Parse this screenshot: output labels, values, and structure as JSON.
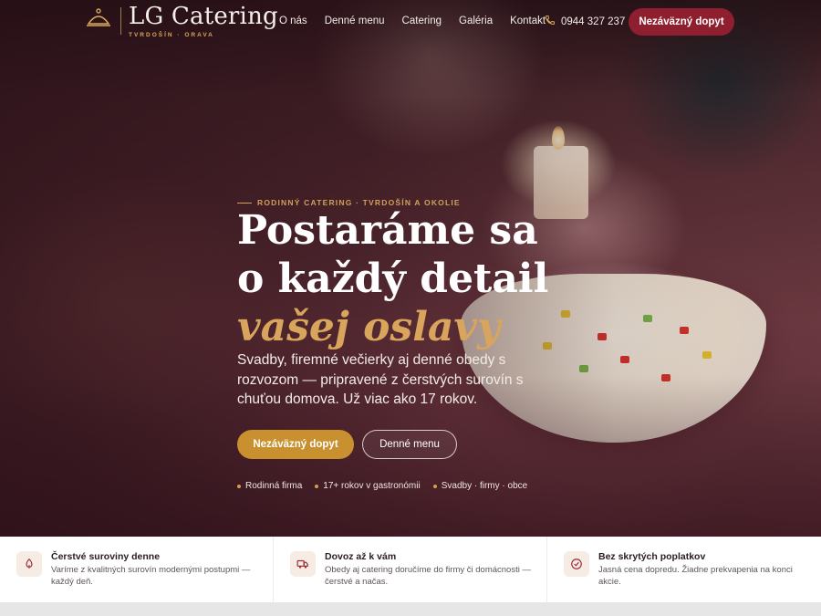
{
  "header": {
    "brand_name": "LG Catering",
    "brand_sub": "TVRDOŠÍN · ORAVA",
    "nav": [
      "O nás",
      "Denné menu",
      "Catering",
      "Galéria",
      "Kontakt"
    ],
    "phone": "0944 327 237",
    "cta_label": "Nezáväzný dopyt"
  },
  "hero": {
    "eyebrow": "RODINNÝ CATERING · TVRDOŠÍN A OKOLIE",
    "title_line1": "Postaráme sa",
    "title_line2": "o každý detail",
    "title_accent": "vašej oslavy",
    "lead": "Svadby, firemné večierky aj denné obedy s rozvozom — pripravené z čerstvých surovín s chuťou domova. Už viac ako 17 rokov.",
    "primary_label": "Nezáväzný dopyt",
    "secondary_label": "Denné menu",
    "facts": [
      "Rodinná firma",
      "17+ rokov v gastronómii",
      "Svadby · firmy · obce"
    ]
  },
  "features": [
    {
      "icon": "leaf-icon",
      "title": "Čerstvé suroviny denne",
      "text": "Varíme z kvalitných surovín modernými postupmi — každý deň."
    },
    {
      "icon": "truck-icon",
      "title": "Dovoz až k vám",
      "text": "Obedy aj catering doručíme do firmy či domácnosti — čerstvé a načas."
    },
    {
      "icon": "check-circle-icon",
      "title": "Bez skrytých poplatkov",
      "text": "Jasná cena dopredu. Žiadne prekvapenia na konci akcie."
    }
  ],
  "colors": {
    "brand_red": "#8f1f2e",
    "gold": "#c8902e",
    "accent_text": "#d9a55c"
  }
}
